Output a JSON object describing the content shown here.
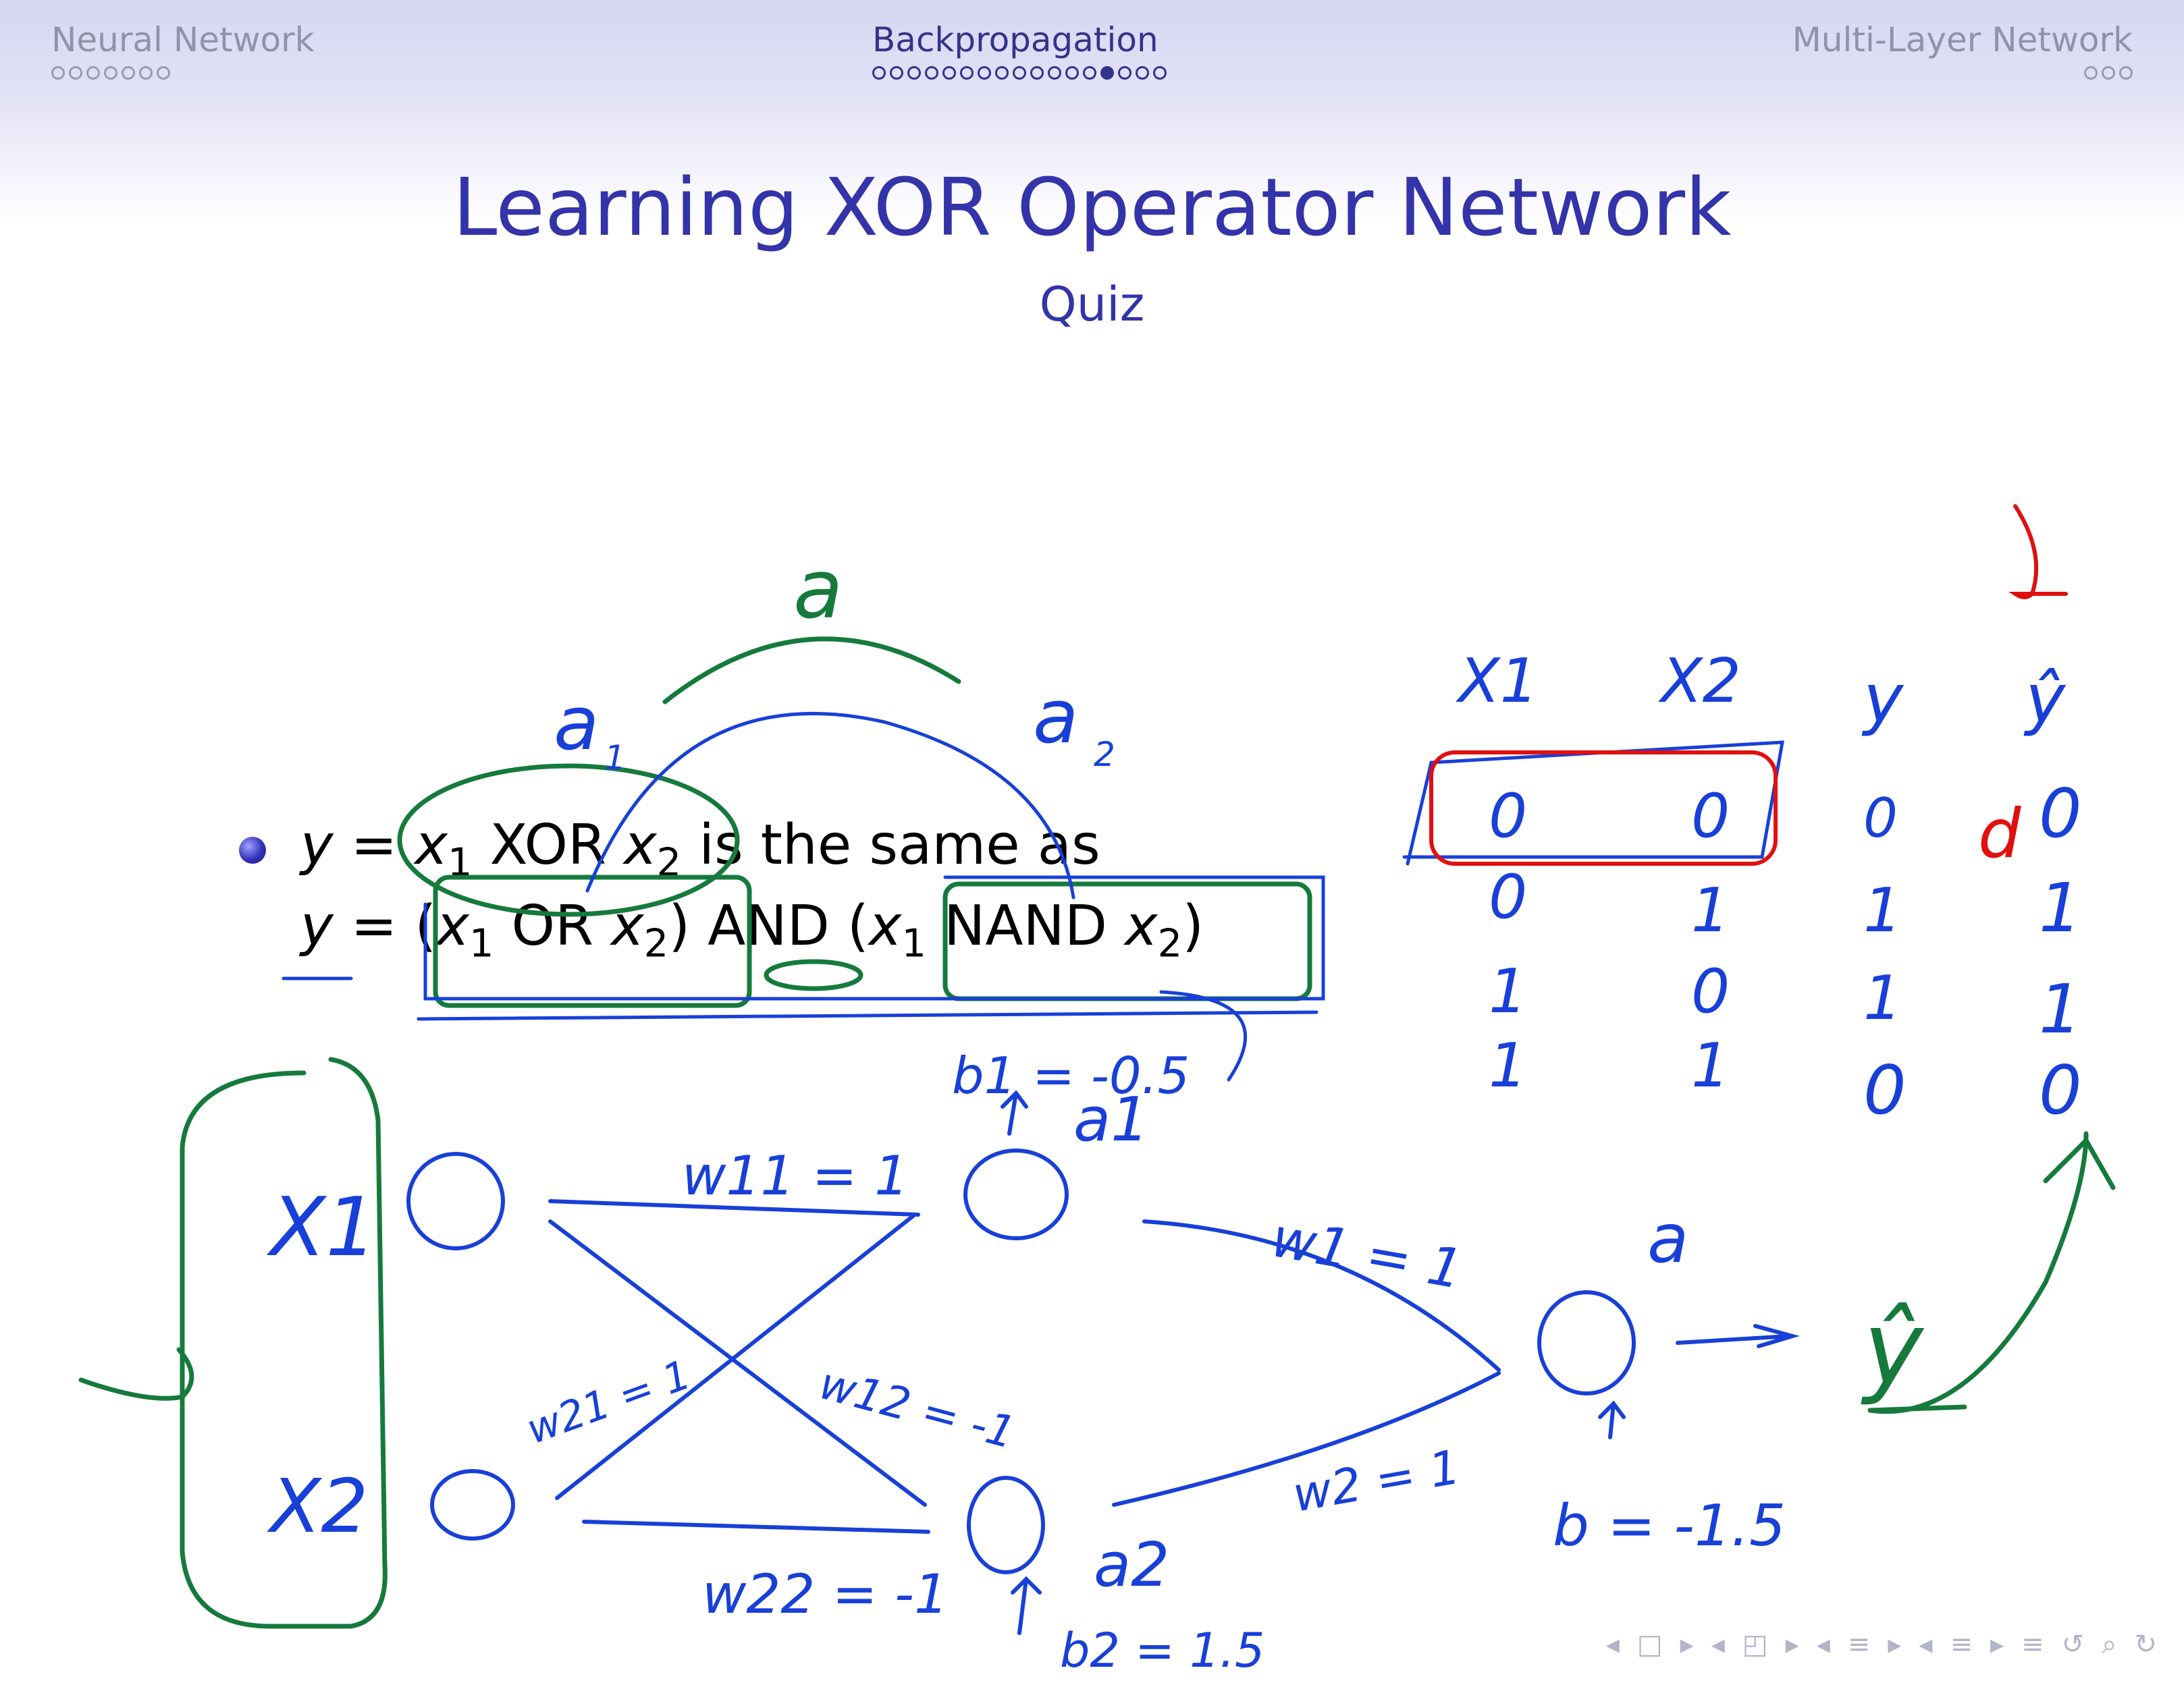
{
  "header": {
    "sections": [
      {
        "title": "Neural Network",
        "dots": 7,
        "current": -1
      },
      {
        "title": "Backpropagation",
        "dots": 17,
        "current": 13
      },
      {
        "title": "Multi-Layer Network",
        "dots": 3,
        "current": -1
      }
    ]
  },
  "slide": {
    "title": "Learning XOR Operator Network",
    "subtitle": "Quiz",
    "bullet": {
      "line1": {
        "y": "y",
        "eq": "=",
        "x1": "x",
        "sub1": "1",
        "op": "XOR",
        "x2": "x",
        "sub2": "2",
        "rest": "is the same as"
      },
      "line2": {
        "y": "y",
        "eq": "=",
        "open1": "(",
        "x1": "x",
        "sub1": "1",
        "op1": "OR",
        "x2": "x",
        "sub2": "2",
        "close1": ")",
        "and": "AND",
        "open2": "(",
        "x3": "x",
        "sub3": "1",
        "op2": "NAND",
        "x4": "x",
        "sub4": "2",
        "close2": ")"
      }
    }
  },
  "annotations": {
    "a_top": "a",
    "a1": "a",
    "a1_sub": "1",
    "a2": "a",
    "a2_sub": "2",
    "table": {
      "headers": [
        "X1",
        "X2",
        "y",
        "ŷ"
      ],
      "rows": [
        [
          "0",
          "0",
          "0",
          "0"
        ],
        [
          "0",
          "1",
          "1",
          "1"
        ],
        [
          "1",
          "0",
          "1",
          "1"
        ],
        [
          "1",
          "1",
          "0",
          "0"
        ]
      ],
      "red_mark": "d"
    },
    "network": {
      "x1_label": "X1",
      "x2_label": "X2",
      "w11": "w11 = 1",
      "w21": "w21 = 1",
      "w12": "w12 = -1",
      "w22": "w22 = -1",
      "b1": "b1 = -0.5",
      "a1_out": "a1",
      "b2": "b2 = 1.5",
      "a2_out": "a2",
      "w1": "w1 = 1",
      "w2": "w2 = 1",
      "b": "b = -1.5",
      "a_out": "a",
      "yhat": "ŷ"
    }
  },
  "navigation": {
    "icons": [
      "frame-prev-icon",
      "frame-icon",
      "frame-next-icon",
      "subsection-prev-icon",
      "subsection-icon",
      "subsection-next-icon",
      "section-prev-icon",
      "section-icon",
      "section-next-icon",
      "slide-prev-icon",
      "slide-icon",
      "slide-next-icon",
      "align-icon",
      "back-icon",
      "search-icon",
      "forward-icon"
    ],
    "symbols": [
      "◂",
      "□",
      "▸",
      "◂",
      "◰",
      "▸",
      "◂",
      "≡",
      "▸",
      "◂",
      "≡",
      "▸",
      "≡",
      "↺",
      "⌕",
      "↻"
    ]
  },
  "colors": {
    "title": "#3333aa",
    "ink_blue": "#1840d8",
    "ink_green": "#157a3c",
    "ink_red": "#e01010"
  }
}
